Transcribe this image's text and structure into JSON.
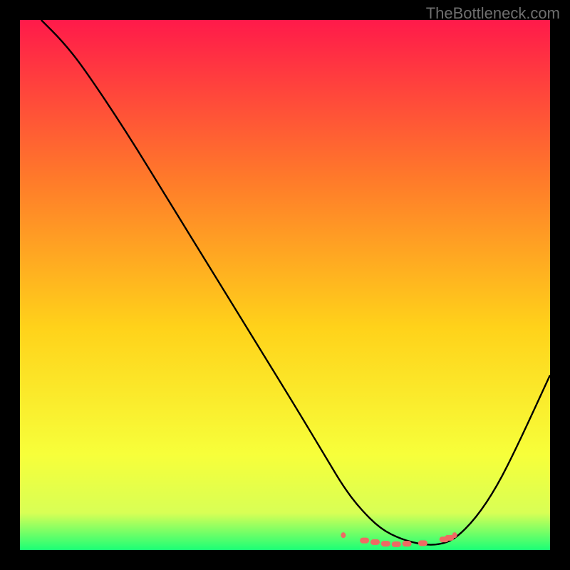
{
  "watermark": "TheBottleneck.com",
  "colors": {
    "top": "#ff1a4a",
    "mid_upper": "#ff7a2a",
    "mid": "#ffd21a",
    "mid_lower": "#f7ff3a",
    "bottom_band": "#d8ff55",
    "bottom": "#1bff76",
    "curve": "#000000",
    "marker": "#ee6a63"
  },
  "chart_data": {
    "type": "line",
    "title": "",
    "xlabel": "",
    "ylabel": "",
    "xlim": [
      0,
      100
    ],
    "ylim": [
      0,
      100
    ],
    "series": [
      {
        "name": "bottleneck-curve",
        "x": [
          4,
          8,
          12,
          20,
          28,
          36,
          44,
          52,
          58,
          61,
          64,
          68,
          72,
          76,
          79,
          82,
          86,
          90,
          94,
          100
        ],
        "y": [
          100,
          96,
          91,
          79,
          66,
          53,
          40,
          27,
          17,
          12,
          8,
          4,
          2,
          1,
          1,
          2,
          6,
          12,
          20,
          33
        ]
      }
    ],
    "markers": {
      "name": "highlight-band",
      "x": [
        61,
        65,
        67,
        69,
        71,
        73,
        76,
        80,
        81,
        82
      ],
      "y": [
        2.8,
        1.8,
        1.5,
        1.2,
        1.1,
        1.2,
        1.3,
        2.0,
        2.3,
        2.8
      ]
    }
  }
}
